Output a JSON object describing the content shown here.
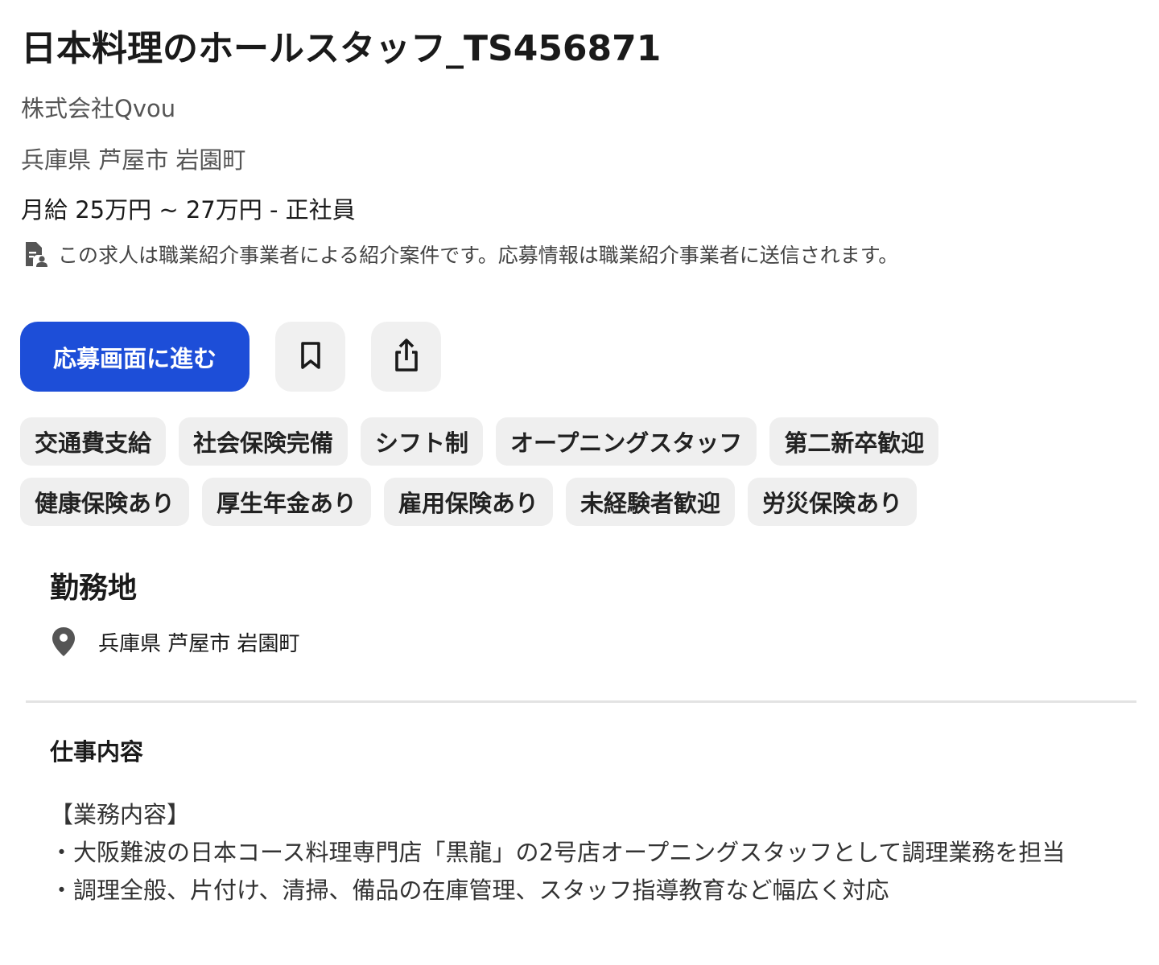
{
  "job": {
    "title": "日本料理のホールスタッフ_TS456871",
    "company": "株式会社Qvou",
    "location": "兵庫県 芦屋市 岩園町",
    "salary": "月給 25万円 ~ 27万円  - 正社員",
    "notice": "この求人は職業紹介事業者による紹介案件です。応募情報は職業紹介事業者に送信されます。",
    "notice_icon": "document-person-icon"
  },
  "actions": {
    "apply_label": "応募画面に進む",
    "bookmark_icon": "bookmark-icon",
    "share_icon": "share-icon",
    "apply_color": "#1d4ed8"
  },
  "tags": {
    "row1": [
      "交通費支給",
      "社会保険完備",
      "シフト制",
      "オープニングスタッフ",
      "第二新卒歓迎"
    ],
    "row2": [
      "健康保険あり",
      "厚生年金あり",
      "雇用保険あり",
      "未経験者歓迎",
      "労災保険あり"
    ]
  },
  "work_location": {
    "heading": "勤務地",
    "address": "兵庫県 芦屋市 岩園町",
    "icon": "map-pin-icon"
  },
  "job_description": {
    "heading": "仕事内容",
    "lines": [
      "【業務内容】",
      "・大阪難波の日本コース料理専門店「黒龍」の2号店オープニングスタッフとして調理業務を担当",
      "・調理全般、片付け、清掃、備品の在庫管理、スタッフ指導教育など幅広く対応"
    ]
  }
}
